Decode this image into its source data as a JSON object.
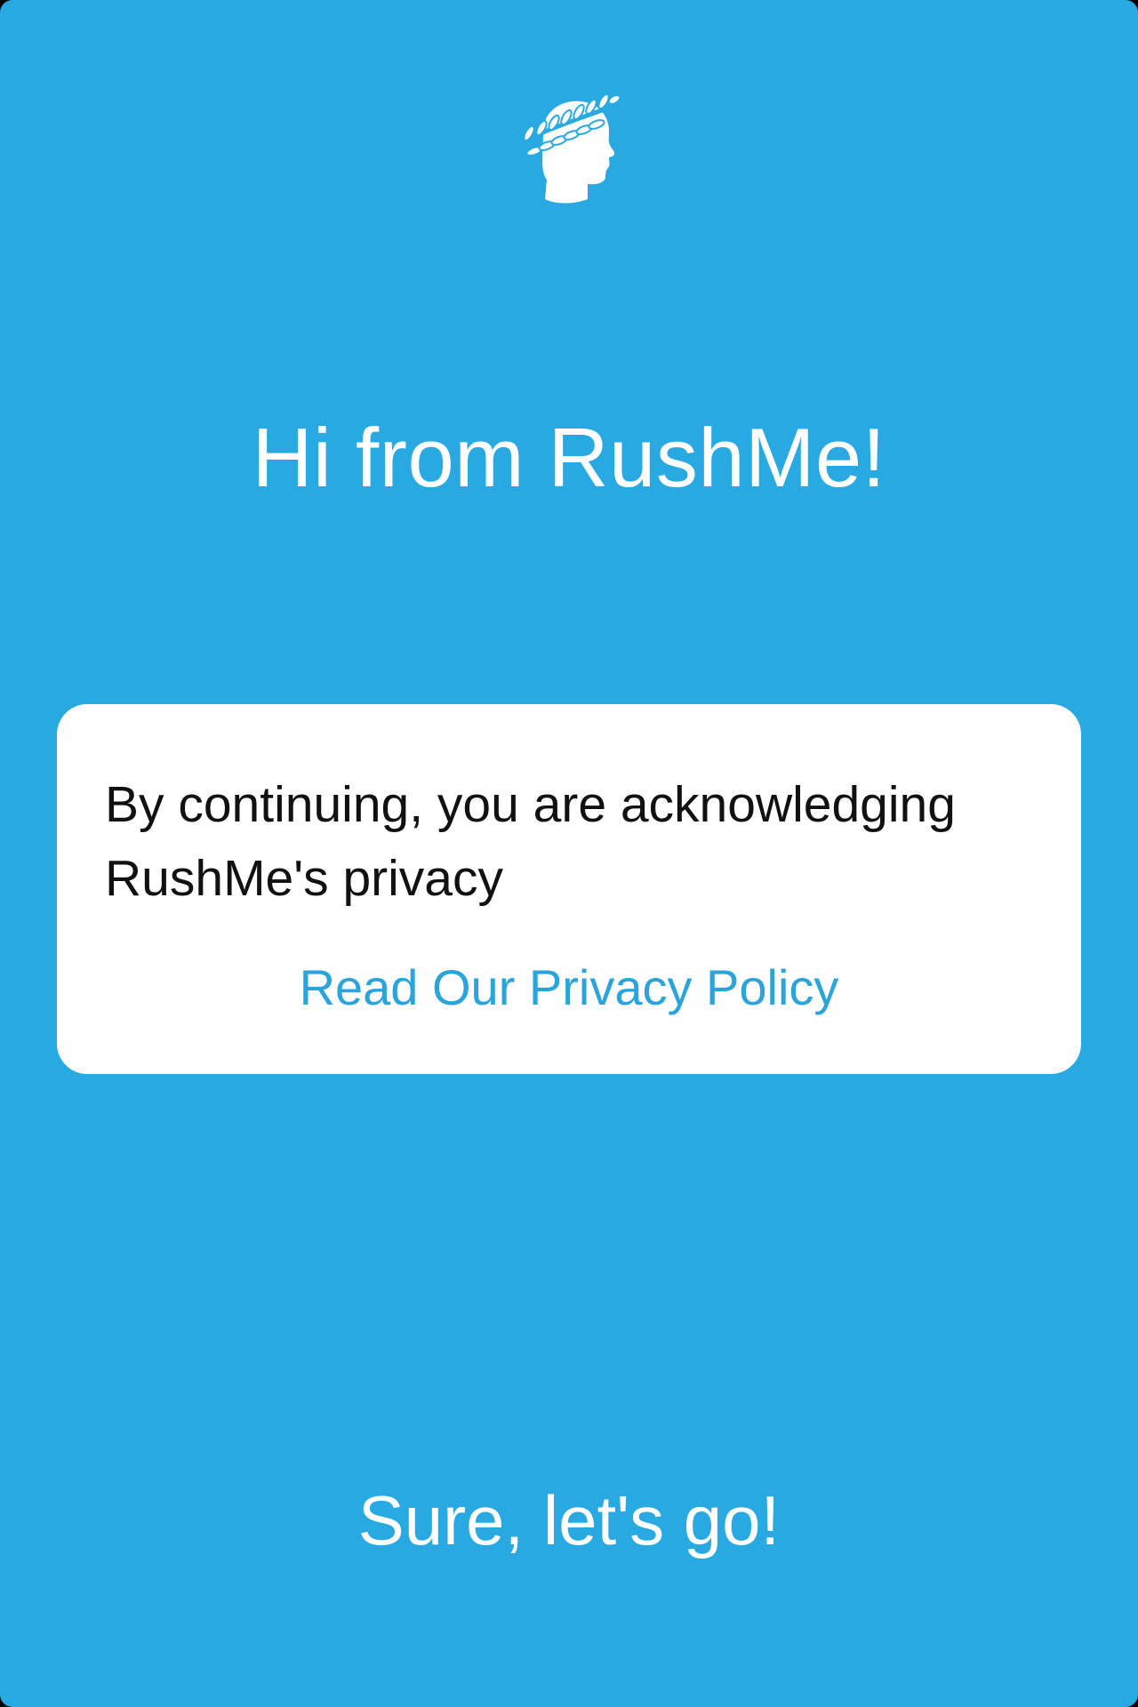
{
  "theme": {
    "background_color": "#29a9e1",
    "card_color": "#ffffff",
    "link_color": "#2aa4db",
    "text_color": "#111111"
  },
  "header": {
    "logo_icon": "laurel-head-icon"
  },
  "main": {
    "headline": "Hi from RushMe!",
    "card": {
      "text": "By continuing, you are acknowledging RushMe's privacy",
      "privacy_link_label": "Read Our Privacy Policy"
    }
  },
  "footer": {
    "continue_label": "Sure, let's go!"
  }
}
